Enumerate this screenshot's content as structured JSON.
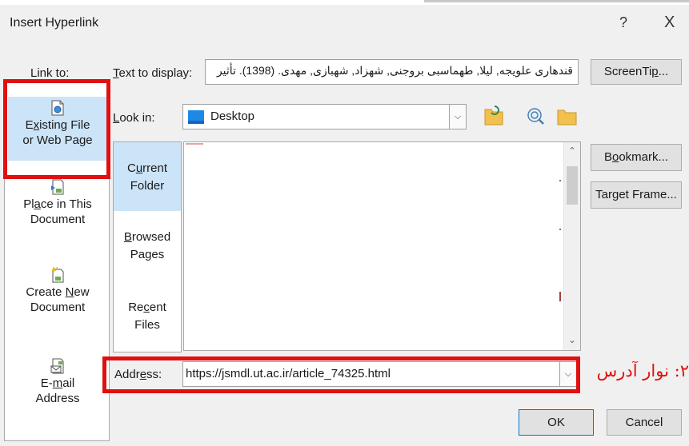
{
  "dialog": {
    "title": "Insert Hyperlink",
    "help_glyph": "?",
    "close_glyph": "X"
  },
  "link_to": {
    "label": "Link to:",
    "items": [
      {
        "pre": "E",
        "ul": "x",
        "post": "isting File",
        "line2": "or Web Page",
        "icon": "web-page-icon",
        "selected": true
      },
      {
        "pre": "Pl",
        "ul": "a",
        "post": "ce in This",
        "line2": "Document",
        "icon": "place-in-document-icon",
        "selected": false
      },
      {
        "pre": "Create ",
        "ul": "N",
        "post": "ew",
        "line2": "Document",
        "icon": "new-document-icon",
        "selected": false
      },
      {
        "pre": "E-",
        "ul": "m",
        "post": "ail",
        "line2": "Address",
        "icon": "email-icon",
        "selected": false
      }
    ]
  },
  "text_to_display": {
    "label_ul": "T",
    "label_rest": "ext to display:",
    "value": "قندهاری علویجه, لیلا, طهماسبی بروجنی, شهزاد, شهبازی, مهدی. (1398). تأثیر"
  },
  "screentip": {
    "pre": "ScreenTi",
    "ul": "p",
    "post": "..."
  },
  "look_in": {
    "label_ul": "L",
    "label_rest": "ook in:",
    "value": "Desktop",
    "icon": "desktop-folder-icon"
  },
  "toolbar_icons": [
    "browse-web-icon",
    "browse-file-icon",
    "up-folder-icon"
  ],
  "nav": {
    "items": [
      {
        "line1_pre": "C",
        "line1_ul": "u",
        "line1_post": "rrent",
        "line2": "Folder",
        "selected": true
      },
      {
        "line1_pre": "",
        "line1_ul": "B",
        "line1_post": "rowsed",
        "line2": "Pages",
        "selected": false
      },
      {
        "line1_pre": "Re",
        "line1_ul": "c",
        "line1_post": "ent",
        "line2": "Files",
        "selected": false
      }
    ]
  },
  "buttons": {
    "bookmark": {
      "pre": "B",
      "ul": "o",
      "post": "okmark..."
    },
    "target_frame": {
      "pre": "Tar",
      "ul": "g",
      "post": "et Frame..."
    },
    "ok": "OK",
    "cancel": "Cancel"
  },
  "address": {
    "label_pre": "Addr",
    "label_ul": "e",
    "label_post": "ss:",
    "value": "https://jsmdl.ut.ac.ir/article_74325.html"
  },
  "annotation": {
    "text": "۲: نوار آدرس",
    "color": "#e01010"
  },
  "colors": {
    "dialog_bg": "#f0f0f0",
    "selected_bg": "#cce4f7",
    "highlight_red": "#e01010"
  }
}
